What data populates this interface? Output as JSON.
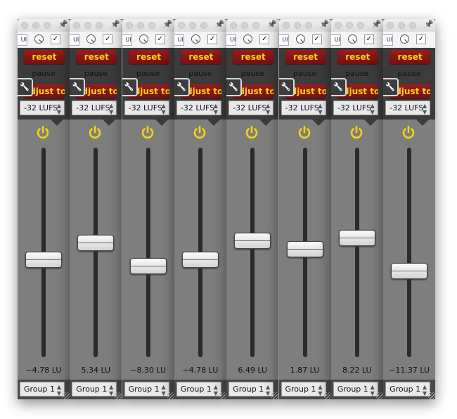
{
  "colors": {
    "accent_yellow": "#f6d40e",
    "button_red": "#8a1717",
    "panel_dark": "#3c3c3c",
    "body_gray": "#7e7e7e"
  },
  "icons": {
    "title_pin": "pushpin-icon",
    "wrench": "wrench-icon",
    "power": "power-icon",
    "knob": "knob-icon"
  },
  "channels": [
    {
      "toolbar_label": "UI",
      "checked": "✓",
      "reset": "reset",
      "pause": "pause",
      "adjust": "adjust to",
      "target": "-32 LUFS",
      "value": -4.78,
      "value_label": "−4.78 LU",
      "group": "Group 1"
    },
    {
      "toolbar_label": "UI",
      "checked": "✓",
      "reset": "reset",
      "pause": "pause",
      "adjust": "adjust to",
      "target": "-32 LUFS",
      "value": 5.34,
      "value_label": "5.34 LU",
      "group": "Group 1"
    },
    {
      "toolbar_label": "UI",
      "checked": "✓",
      "reset": "reset",
      "pause": "pause",
      "adjust": "adjust to",
      "target": "-32 LUFS",
      "value": -8.3,
      "value_label": "−8.30 LU",
      "group": "Group 1"
    },
    {
      "toolbar_label": "UI",
      "checked": "✓",
      "reset": "reset",
      "pause": "pause",
      "adjust": "adjust to",
      "target": "-32 LUFS",
      "value": -4.78,
      "value_label": "−4.78 LU",
      "group": "Group 1"
    },
    {
      "toolbar_label": "UI",
      "checked": "✓",
      "reset": "reset",
      "pause": "pause",
      "adjust": "adjust to",
      "target": "-32 LUFS",
      "value": 6.49,
      "value_label": "6.49 LU",
      "group": "Group 1"
    },
    {
      "toolbar_label": "UI",
      "checked": "✓",
      "reset": "reset",
      "pause": "pause",
      "adjust": "adjust to",
      "target": "-32 LUFS",
      "value": 1.87,
      "value_label": "1.87 LU",
      "group": "Group 1"
    },
    {
      "toolbar_label": "UI",
      "checked": "✓",
      "reset": "reset",
      "pause": "pause",
      "adjust": "adjust to",
      "target": "-32 LUFS",
      "value": 8.22,
      "value_label": "8.22 LU",
      "group": "Group 1"
    },
    {
      "toolbar_label": "UI",
      "checked": "✓",
      "reset": "reset",
      "pause": "pause",
      "adjust": "adjust to",
      "target": "-32 LUFS",
      "value": -11.37,
      "value_label": "−11.37 LU",
      "group": "Group 1"
    }
  ]
}
